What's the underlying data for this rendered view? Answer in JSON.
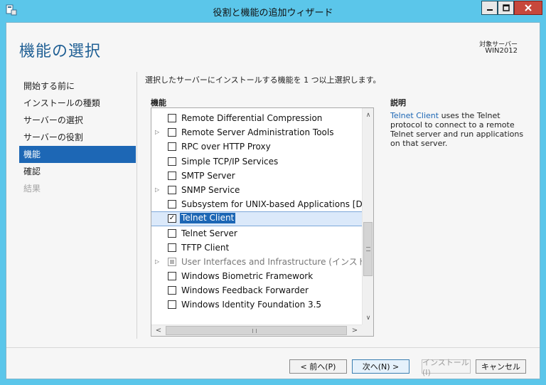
{
  "window": {
    "title": "役割と機能の追加ウィザード",
    "accent_color": "#5bc6ea"
  },
  "page": {
    "title": "機能の選択",
    "target_label": "対象サーバー",
    "target_value": "WIN2012",
    "instruction": "選択したサーバーにインストールする機能を 1 つ以上選択します。"
  },
  "nav": {
    "items": [
      {
        "label": "開始する前に",
        "state": "normal"
      },
      {
        "label": "インストールの種類",
        "state": "normal"
      },
      {
        "label": "サーバーの選択",
        "state": "normal"
      },
      {
        "label": "サーバーの役割",
        "state": "normal"
      },
      {
        "label": "機能",
        "state": "active"
      },
      {
        "label": "確認",
        "state": "normal"
      },
      {
        "label": "結果",
        "state": "disabled"
      }
    ]
  },
  "features": {
    "header": "機能",
    "items": [
      {
        "label": "Remote Differential Compression",
        "expandable": false,
        "checked": "no"
      },
      {
        "label": "Remote Server Administration Tools",
        "expandable": true,
        "checked": "no"
      },
      {
        "label": "RPC over HTTP Proxy",
        "expandable": false,
        "checked": "no"
      },
      {
        "label": "Simple TCP/IP Services",
        "expandable": false,
        "checked": "no"
      },
      {
        "label": "SMTP Server",
        "expandable": false,
        "checked": "no"
      },
      {
        "label": "SNMP Service",
        "expandable": true,
        "checked": "no"
      },
      {
        "label": "Subsystem for UNIX-based Applications [Dep",
        "expandable": false,
        "checked": "no"
      },
      {
        "label": "Telnet Client",
        "expandable": false,
        "checked": "yes",
        "selected": true
      },
      {
        "label": "Telnet Server",
        "expandable": false,
        "checked": "no"
      },
      {
        "label": "TFTP Client",
        "expandable": false,
        "checked": "no"
      },
      {
        "label": "User Interfaces and Infrastructure (インストール",
        "expandable": true,
        "checked": "partial",
        "greyed": true
      },
      {
        "label": "Windows Biometric Framework",
        "expandable": false,
        "checked": "no"
      },
      {
        "label": "Windows Feedback Forwarder",
        "expandable": false,
        "checked": "no"
      },
      {
        "label": "Windows Identity Foundation 3.5",
        "expandable": false,
        "checked": "no"
      }
    ]
  },
  "description": {
    "header": "説明",
    "link_text": "Telnet Client",
    "text": " uses the Telnet protocol to connect to a remote Telnet server and run applications on that server."
  },
  "buttons": {
    "prev": "< 前へ(P)",
    "next": "次へ(N) >",
    "install": "インストール(I)",
    "cancel": "キャンセル"
  },
  "icons": {
    "check": "✓",
    "expander": "▷",
    "scroll_up": "∧",
    "scroll_down": "∨",
    "scroll_left": "<",
    "scroll_right": ">"
  }
}
